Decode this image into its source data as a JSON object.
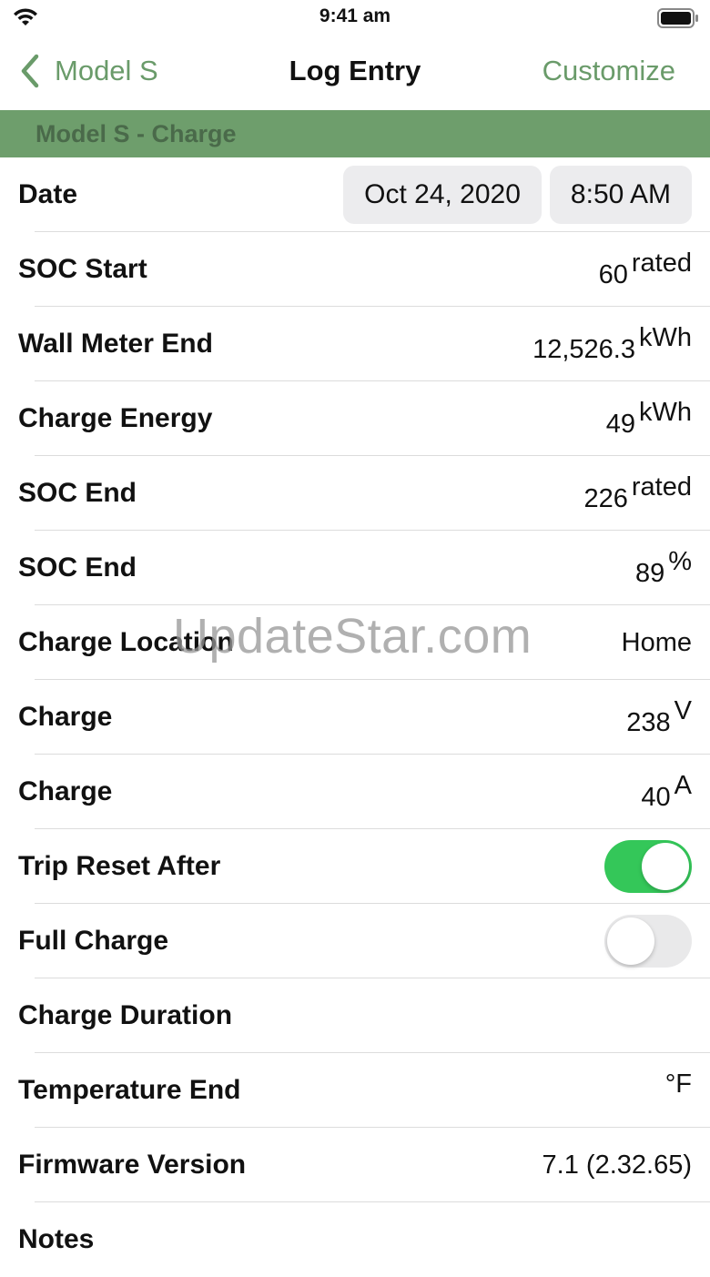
{
  "status_bar": {
    "time": "9:41 am"
  },
  "nav": {
    "back_label": "Model S",
    "title": "Log Entry",
    "action_label": "Customize"
  },
  "section": {
    "title": "Model S - Charge"
  },
  "form": {
    "date": {
      "label": "Date",
      "date_value": "Oct 24, 2020",
      "time_value": "8:50 AM"
    },
    "soc_start": {
      "label": "SOC Start",
      "value": "60",
      "unit": "rated"
    },
    "wall_meter_end": {
      "label": "Wall Meter End",
      "value": "12,526.3",
      "unit": "kWh"
    },
    "charge_energy": {
      "label": "Charge Energy",
      "value": "49",
      "unit": "kWh"
    },
    "soc_end_rated": {
      "label": "SOC End",
      "value": "226",
      "unit": "rated"
    },
    "soc_end_percent": {
      "label": "SOC End",
      "value": "89",
      "unit": "%"
    },
    "charge_location": {
      "label": "Charge Location",
      "value": "Home"
    },
    "charge_voltage": {
      "label": "Charge",
      "value": "238",
      "unit": "V"
    },
    "charge_current": {
      "label": "Charge",
      "value": "40",
      "unit": "A"
    },
    "trip_reset_after": {
      "label": "Trip Reset After",
      "on": true
    },
    "full_charge": {
      "label": "Full Charge",
      "on": false
    },
    "charge_duration": {
      "label": "Charge Duration",
      "value": ""
    },
    "temperature_end": {
      "label": "Temperature End",
      "value": "",
      "unit": "°F"
    },
    "firmware_version": {
      "label": "Firmware Version",
      "value": "7.1 (2.32.65)"
    },
    "notes": {
      "label": "Notes"
    }
  },
  "watermark": "UpdateStar.com",
  "colors": {
    "accent": "#6a9b6a",
    "header_bg": "#6e9e6c",
    "toggle_on": "#34c759"
  }
}
